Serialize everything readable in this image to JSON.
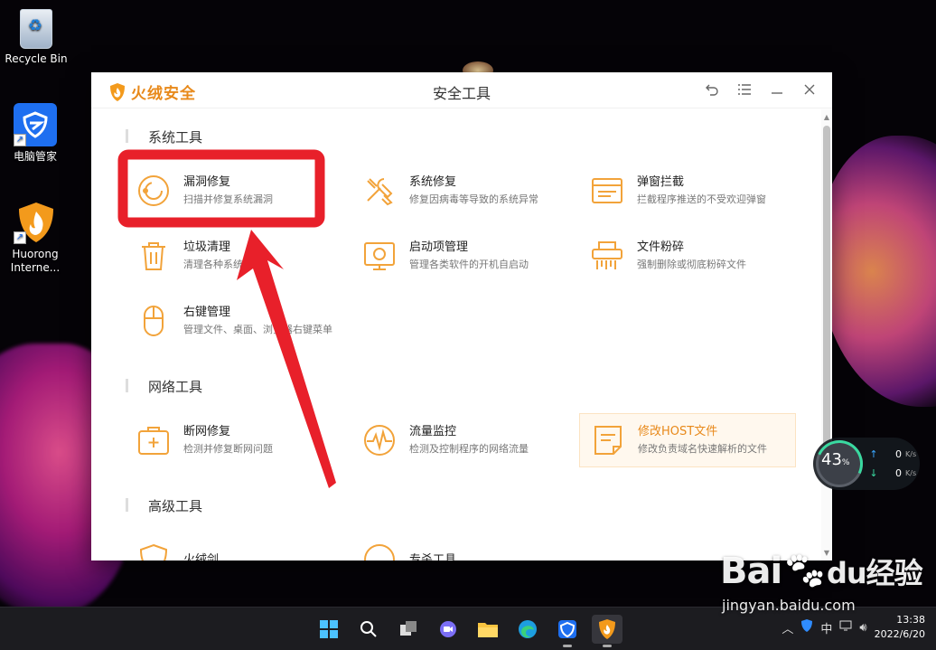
{
  "desktop": {
    "icons": [
      {
        "label": "Recycle Bin"
      },
      {
        "label": "电脑管家"
      },
      {
        "label": "Huorong Interne..."
      }
    ]
  },
  "window": {
    "brand": "火绒安全",
    "title": "安全工具",
    "controls": [
      "back-icon",
      "menu-icon",
      "minimize-icon",
      "close-icon"
    ]
  },
  "sections": [
    {
      "title": "系统工具",
      "tools": [
        {
          "name": "漏洞修复",
          "desc": "扫描并修复系统漏洞",
          "icon": "vulnerability-fix-icon"
        },
        {
          "name": "系统修复",
          "desc": "修复因病毒等导致的系统异常",
          "icon": "system-repair-icon"
        },
        {
          "name": "弹窗拦截",
          "desc": "拦截程序推送的不受欢迎弹窗",
          "icon": "popup-block-icon"
        },
        {
          "name": "垃圾清理",
          "desc": "清理各种系统垃圾",
          "icon": "trash-icon"
        },
        {
          "name": "启动项管理",
          "desc": "管理各类软件的开机自启动",
          "icon": "startup-icon"
        },
        {
          "name": "文件粉碎",
          "desc": "强制删除或彻底粉碎文件",
          "icon": "shredder-icon"
        },
        {
          "name": "右键管理",
          "desc": "管理文件、桌面、浏览器右键菜单",
          "icon": "mouse-icon"
        }
      ]
    },
    {
      "title": "网络工具",
      "tools": [
        {
          "name": "断网修复",
          "desc": "检测并修复断网问题",
          "icon": "network-fix-icon"
        },
        {
          "name": "流量监控",
          "desc": "检测及控制程序的网络流量",
          "icon": "traffic-monitor-icon"
        },
        {
          "name": "修改HOST文件",
          "desc": "修改负责域名快速解析的文件",
          "icon": "host-file-icon"
        }
      ]
    },
    {
      "title": "高级工具",
      "tools": [
        {
          "name": "火绒剑",
          "icon": "huorong-sword-icon"
        },
        {
          "name": "专杀工具",
          "icon": "special-kill-icon"
        }
      ]
    }
  ],
  "speed_widget": {
    "percent": "43",
    "percent_unit": "%",
    "up": "0",
    "down": "0",
    "unit": "K/s"
  },
  "taskbar": {
    "apps": [
      "start-icon",
      "search-icon",
      "task-view-icon",
      "chat-icon",
      "file-explorer-icon",
      "edge-icon",
      "tencent-manager-icon",
      "huorong-icon"
    ],
    "ime": "中",
    "time": "13:38",
    "date": "2022/6/20"
  },
  "watermark": {
    "brand": "Bai",
    "brand_cn": "经验",
    "url": "jingyan.baidu.com"
  },
  "colors": {
    "accent": "#e8891a",
    "annotation": "#e8202a"
  }
}
